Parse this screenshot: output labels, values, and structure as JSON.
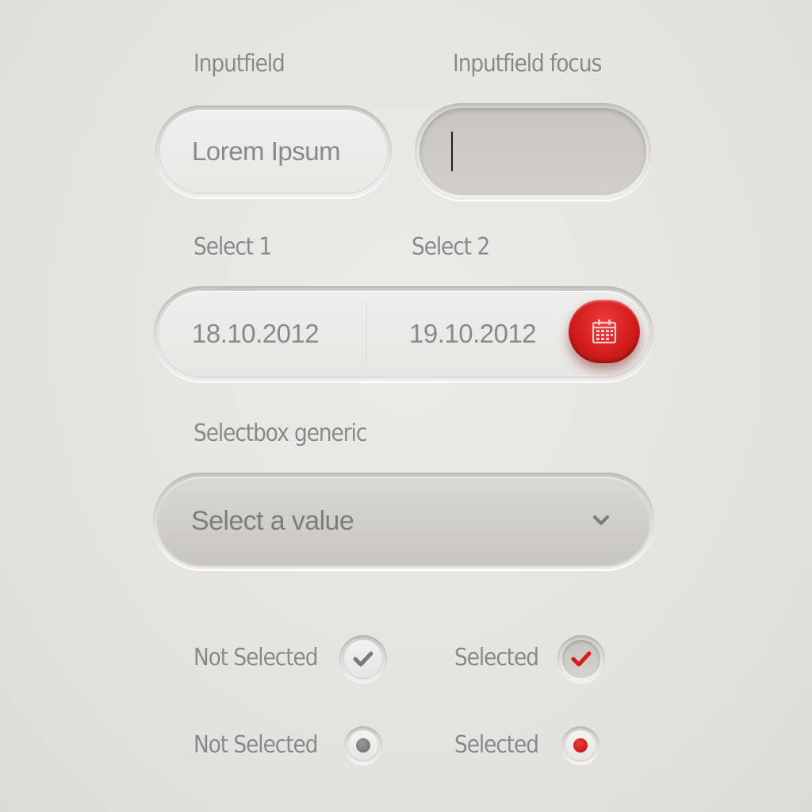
{
  "labels": {
    "inputfield": "Inputfield",
    "inputfield_focus": "Inputfield focus",
    "select1": "Select 1",
    "select2": "Select 2",
    "selectbox_generic": "Selectbox generic",
    "checkbox_not_selected": "Not Selected",
    "checkbox_selected": "Selected",
    "radio_not_selected": "Not Selected",
    "radio_selected": "Selected"
  },
  "inputs": {
    "normal_value": "Lorem Ipsum",
    "focus_value": ""
  },
  "dates": {
    "select1_value": "18.10.2012",
    "select2_value": "19.10.2012",
    "calendar_icon": "calendar-icon"
  },
  "selectbox": {
    "placeholder": "Select a value",
    "icon": "chevron-down-icon"
  },
  "checkboxes": [
    {
      "label": "Not Selected",
      "checked": false
    },
    {
      "label": "Selected",
      "checked": true
    }
  ],
  "radios": [
    {
      "label": "Not Selected",
      "checked": false
    },
    {
      "label": "Selected",
      "checked": true
    }
  ],
  "colors": {
    "accent": "#d41d1d",
    "label": "#8a8886",
    "unchecked_mark": "#7d7b79"
  }
}
